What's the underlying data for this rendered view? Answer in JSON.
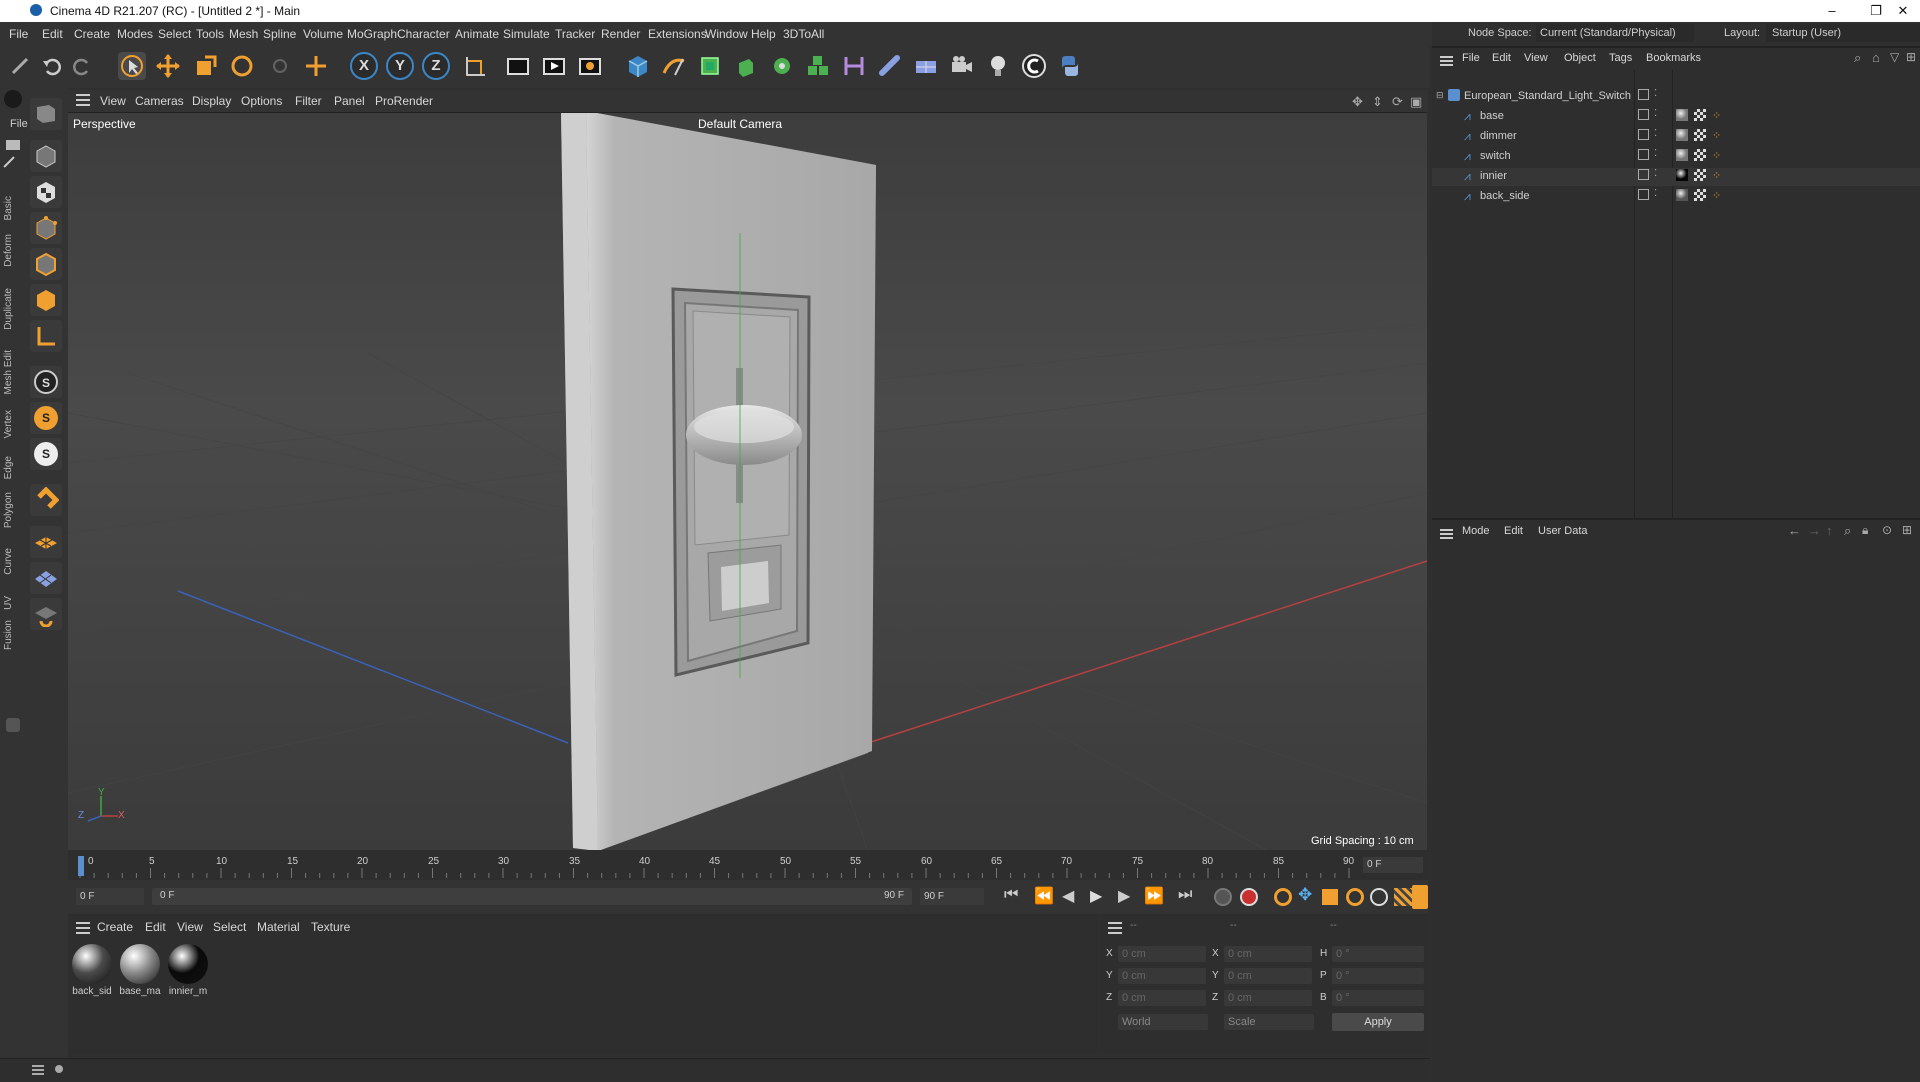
{
  "window": {
    "title": "Cinema 4D R21.207 (RC) - [Untitled 2 *] - Main",
    "controls": [
      "–",
      "❐",
      "✕"
    ]
  },
  "menubar": {
    "items": [
      "File",
      "Edit",
      "Create",
      "Modes",
      "Select",
      "Tools",
      "Mesh",
      "Spline",
      "Volume",
      "MoGraph",
      "Character",
      "Animate",
      "Simulate",
      "Tracker",
      "Render",
      "Extensions",
      "Window",
      "Help",
      "3DToAll"
    ],
    "node_space_label": "Node Space:",
    "node_space_value": "Current (Standard/Physical)",
    "layout_label": "Layout:",
    "layout_value": "Startup (User)"
  },
  "toolbar": {
    "axis_labels": [
      "X",
      "Y",
      "Z"
    ]
  },
  "left_palette": {
    "file_label": "File",
    "tabs": [
      "Basic",
      "Deform",
      "Duplicate",
      "Mesh Edit",
      "Vertex",
      "Edge",
      "Polygon",
      "Curve",
      "UV",
      "Fusion"
    ],
    "s_buttons": [
      "S",
      "S",
      "S"
    ]
  },
  "viewport": {
    "menu": [
      "View",
      "Cameras",
      "Display",
      "Options",
      "Filter",
      "Panel",
      "ProRender"
    ],
    "view_name": "Perspective",
    "camera_name": "Default Camera",
    "grid_spacing": "Grid Spacing : 10 cm",
    "axis_y": "Y",
    "axis_z": "Z",
    "axis_x": "X"
  },
  "timeline": {
    "ticks": [
      "0",
      "5",
      "10",
      "15",
      "20",
      "25",
      "30",
      "35",
      "40",
      "45",
      "50",
      "55",
      "60",
      "65",
      "70",
      "75",
      "80",
      "85",
      "90"
    ],
    "current_frame_field": "0 F"
  },
  "playback": {
    "start_field": "0 F",
    "range_start": "0 F",
    "range_end": "90 F",
    "end_field": "90 F"
  },
  "material_manager": {
    "menu": [
      "Create",
      "Edit",
      "View",
      "Select",
      "Material",
      "Texture"
    ],
    "materials": [
      {
        "label": "back_sid",
        "color": "#4a4a4a"
      },
      {
        "label": "base_ma",
        "color": "#8a8a8a"
      },
      {
        "label": "innier_m",
        "color": "#0a0a0a"
      }
    ]
  },
  "coordinates": {
    "headers": [
      "--",
      "--",
      "--"
    ],
    "rows": [
      {
        "a": "X",
        "a_val": "0 cm",
        "b": "X",
        "b_val": "0 cm",
        "c": "H",
        "c_val": "0 °"
      },
      {
        "a": "Y",
        "a_val": "0 cm",
        "b": "Y",
        "b_val": "0 cm",
        "c": "P",
        "c_val": "0 °"
      },
      {
        "a": "Z",
        "a_val": "0 cm",
        "b": "Z",
        "b_val": "0 cm",
        "c": "B",
        "c_val": "0 °"
      }
    ],
    "space_select": "World",
    "mode_select": "Scale",
    "apply_label": "Apply"
  },
  "object_manager": {
    "menu": [
      "File",
      "Edit",
      "View",
      "Object",
      "Tags",
      "Bookmarks"
    ],
    "root": "European_Standard_Light_Switch",
    "children": [
      {
        "name": "base",
        "tag_color": "#777777"
      },
      {
        "name": "dimmer",
        "tag_color": "#777777"
      },
      {
        "name": "switch",
        "tag_color": "#777777"
      },
      {
        "name": "innier",
        "tag_color": "#050505"
      },
      {
        "name": "back_side",
        "tag_color": "#555555"
      }
    ]
  },
  "attribute_manager": {
    "menu": [
      "Mode",
      "Edit",
      "User Data"
    ]
  },
  "colors": {
    "accent_orange": "#f0a030",
    "accent_blue": "#3c87c8",
    "selection_green": "#4caf50"
  }
}
